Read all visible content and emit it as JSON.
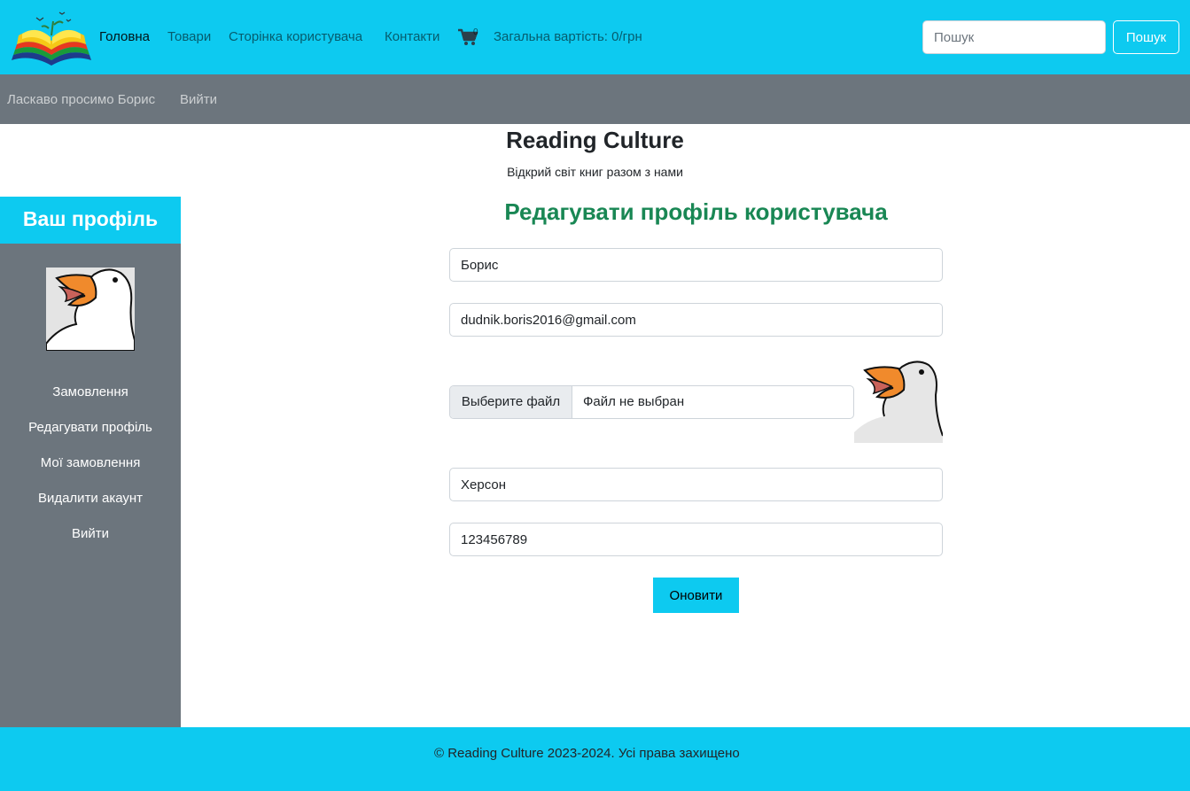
{
  "nav": {
    "links": [
      "Головна",
      "Товари",
      "Сторінка користувача",
      "Контакти"
    ],
    "cart_count": "0",
    "total": "Загальна вартість: 0/грн",
    "search_placeholder": "Пошук",
    "search_button": "Пошук"
  },
  "usernav": {
    "welcome": "Ласкаво просимо Борис",
    "logout": "Вийти"
  },
  "site": {
    "title": "Reading Culture",
    "subtitle": "Відкрий світ книг разом з нами"
  },
  "sidebar": {
    "title": "Ваш профіль",
    "items": [
      "Замовлення",
      "Редагувати профіль",
      "Мої замовлення",
      "Видалити акаунт",
      "Вийти"
    ]
  },
  "form": {
    "title": "Редагувати профіль користувача",
    "name": "Борис",
    "email": "dudnik.boris2016@gmail.com",
    "file_button": "Выберите файл",
    "file_status": "Файл не выбран",
    "city": "Херсон",
    "phone": "123456789",
    "submit": "Оновити"
  },
  "footer": {
    "text": "© Reading Culture 2023-2024. Усі права захищено"
  },
  "colors": {
    "brand": "#0dcaf0",
    "sidebar": "#6c757d",
    "heading_green": "#198754"
  },
  "icons": [
    "book-logo-icon",
    "cart-icon",
    "goose-avatar-icon"
  ]
}
